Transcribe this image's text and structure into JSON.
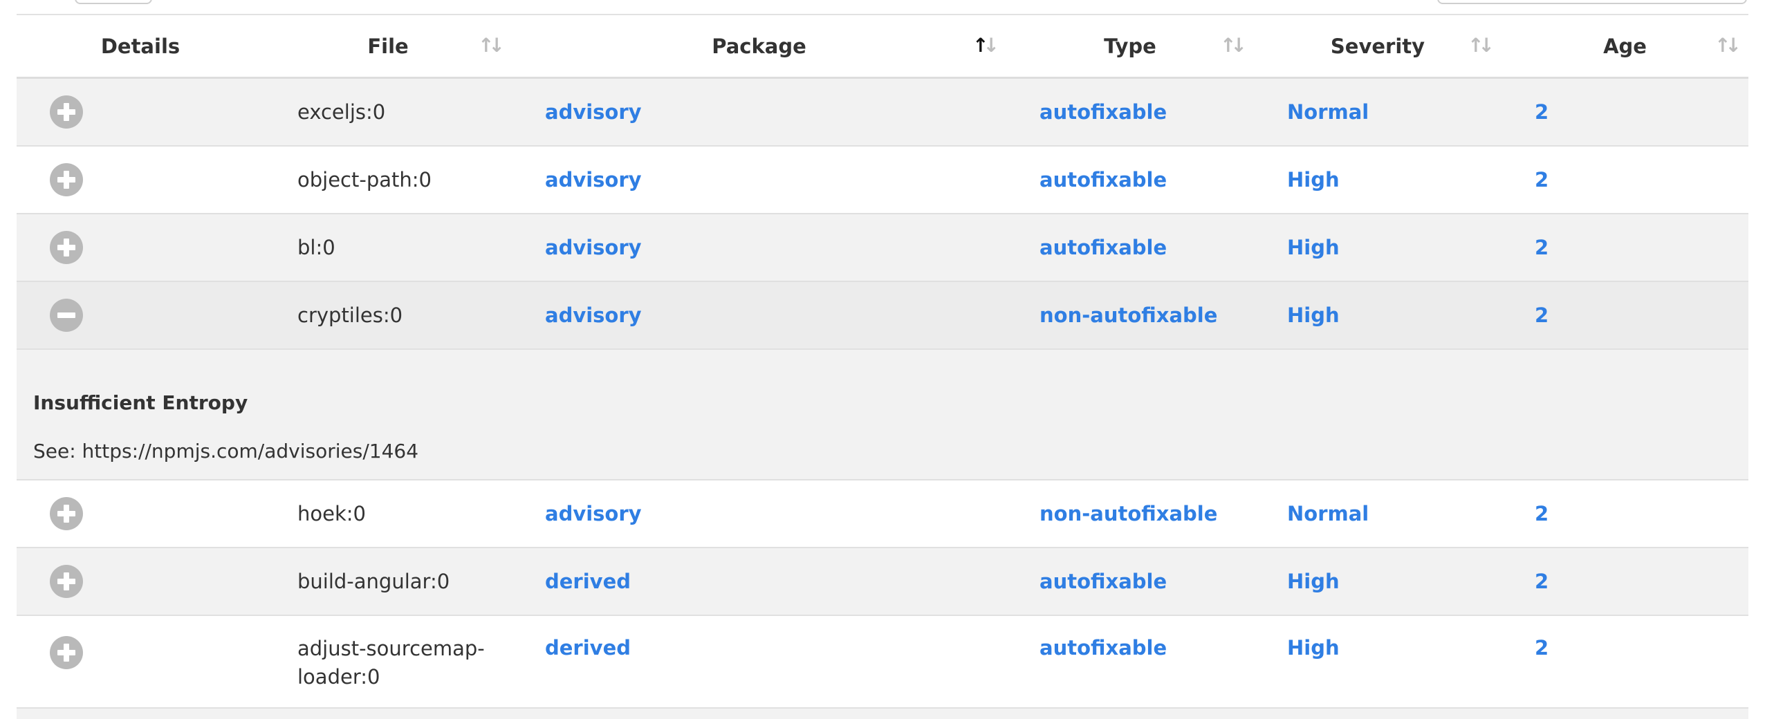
{
  "table": {
    "columns": [
      {
        "key": "details",
        "label": "Details",
        "sortable": false,
        "sort": "none"
      },
      {
        "key": "file",
        "label": "File",
        "sortable": true,
        "sort": "none"
      },
      {
        "key": "package",
        "label": "Package",
        "sortable": true,
        "sort": "ascending"
      },
      {
        "key": "type",
        "label": "Type",
        "sortable": true,
        "sort": "none"
      },
      {
        "key": "severity",
        "label": "Severity",
        "sortable": true,
        "sort": "none"
      },
      {
        "key": "age",
        "label": "Age",
        "sortable": true,
        "sort": "none"
      }
    ],
    "rows": [
      {
        "file": "exceljs:0",
        "package": "advisory",
        "type": "autofixable",
        "severity": "Normal",
        "age": "2",
        "expanded": false
      },
      {
        "file": "object-path:0",
        "package": "advisory",
        "type": "autofixable",
        "severity": "High",
        "age": "2",
        "expanded": false
      },
      {
        "file": "bl:0",
        "package": "advisory",
        "type": "autofixable",
        "severity": "High",
        "age": "2",
        "expanded": false
      },
      {
        "file": "cryptiles:0",
        "package": "advisory",
        "type": "non-autofixable",
        "severity": "High",
        "age": "2",
        "expanded": true
      },
      {
        "file": "hoek:0",
        "package": "advisory",
        "type": "non-autofixable",
        "severity": "Normal",
        "age": "2",
        "expanded": false
      },
      {
        "file": "build-angular:0",
        "package": "derived",
        "type": "autofixable",
        "severity": "High",
        "age": "2",
        "expanded": false
      },
      {
        "file": "adjust-sourcemap-loader:0",
        "file_lines": [
          "adjust-sourcemap-",
          "loader:0"
        ],
        "package": "derived",
        "type": "autofixable",
        "severity": "High",
        "age": "2",
        "expanded": false
      }
    ],
    "detail": {
      "title": "Insufficient Entropy",
      "see": "See: https://npmjs.com/advisories/1464"
    }
  },
  "icons": {
    "expand": "plus-circle-icon",
    "collapse": "minus-circle-icon",
    "sort": "sort-arrows-icon"
  },
  "colors": {
    "link": "#2f7ee3",
    "toggle": "#b9b9b9",
    "row_shade": "#f2f2f2",
    "text": "#333333"
  }
}
